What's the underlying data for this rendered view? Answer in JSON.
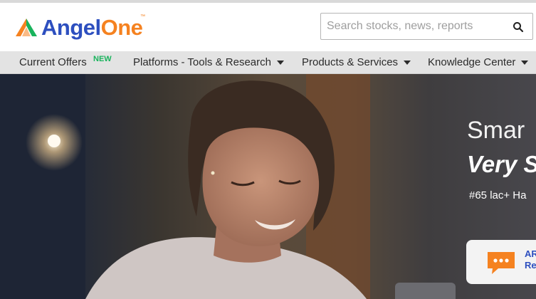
{
  "brand": {
    "name_part1": "Angel",
    "name_part2": "One",
    "trademark": "™",
    "colors": {
      "blue": "#2d4fbf",
      "orange": "#f58220",
      "green": "#19b35c"
    }
  },
  "search": {
    "placeholder": "Search stocks, news, reports",
    "value": "",
    "icon": "search-icon"
  },
  "nav": {
    "items": [
      {
        "label": "Current Offers",
        "badge": "NEW",
        "has_dropdown": false
      },
      {
        "label": "Platforms - Tools & Research",
        "has_dropdown": true
      },
      {
        "label": "Products & Services",
        "has_dropdown": true
      },
      {
        "label": "Knowledge Center",
        "has_dropdown": true
      }
    ]
  },
  "hero": {
    "headline_line1": "Smar",
    "headline_line2": "Very S",
    "subtext": "#65 lac+ Ha",
    "card": {
      "icon": "chat-icon",
      "line1": "AR",
      "line2": "Re"
    }
  }
}
